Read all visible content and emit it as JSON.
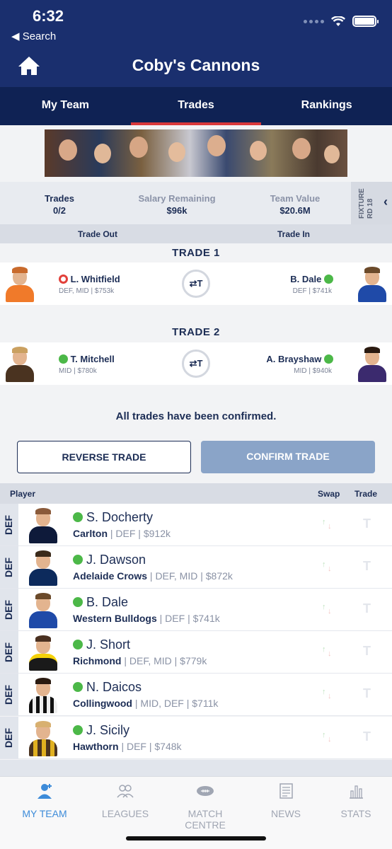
{
  "status": {
    "time": "6:32",
    "back_label": "Search"
  },
  "header": {
    "title": "Coby's Cannons"
  },
  "tabs": [
    {
      "label": "My Team"
    },
    {
      "label": "Trades"
    },
    {
      "label": "Rankings"
    }
  ],
  "summary": {
    "trades": {
      "label": "Trades",
      "value": "0/2"
    },
    "salary": {
      "label": "Salary Remaining",
      "value": "$96k"
    },
    "team_value": {
      "label": "Team Value",
      "value": "$20.6M"
    },
    "fixture_line1": "FIXTURE",
    "fixture_line2": "RD 18"
  },
  "trade_header": {
    "out_label": "Trade Out",
    "in_label": "Trade In"
  },
  "trades": [
    {
      "title": "TRADE 1",
      "out": {
        "name": "L. Whitfield",
        "meta": "DEF, MID | $753k",
        "status": "injured"
      },
      "in": {
        "name": "B. Dale",
        "meta": "DEF | $741k",
        "status": "available"
      },
      "swap_label": "⇄T"
    },
    {
      "title": "TRADE 2",
      "out": {
        "name": "T. Mitchell",
        "meta": "MID | $780k",
        "status": "available"
      },
      "in": {
        "name": "A. Brayshaw",
        "meta": "MID | $940k",
        "status": "available"
      },
      "swap_label": "⇄T"
    }
  ],
  "confirmation_message": "All trades have been confirmed.",
  "buttons": {
    "reverse": "REVERSE TRADE",
    "confirm": "CONFIRM TRADE"
  },
  "list_header": {
    "player": "Player",
    "swap": "Swap",
    "trade": "Trade"
  },
  "players": [
    {
      "pos": "DEF",
      "name": "S. Docherty",
      "club": "Carlton",
      "details": " | DEF | $912k"
    },
    {
      "pos": "DEF",
      "name": "J. Dawson",
      "club": "Adelaide Crows",
      "details": " | DEF, MID | $872k"
    },
    {
      "pos": "DEF",
      "name": "B. Dale",
      "club": "Western Bulldogs",
      "details": " | DEF | $741k"
    },
    {
      "pos": "DEF",
      "name": "J. Short",
      "club": "Richmond",
      "details": " | DEF, MID | $779k"
    },
    {
      "pos": "DEF",
      "name": "N. Daicos",
      "club": "Collingwood",
      "details": " | MID, DEF | $711k"
    },
    {
      "pos": "DEF",
      "name": "J. Sicily",
      "club": "Hawthorn",
      "details": " | DEF | $748k"
    }
  ],
  "nav": [
    {
      "label": "MY TEAM",
      "icon": "person-plus-icon"
    },
    {
      "label": "LEAGUES",
      "icon": "group-icon"
    },
    {
      "label": "MATCH CENTRE",
      "icon": "football-icon"
    },
    {
      "label": "NEWS",
      "icon": "newspaper-icon"
    },
    {
      "label": "STATS",
      "icon": "bar-chart-icon"
    }
  ],
  "colors": {
    "navy": "#1a2f6e",
    "dark_navy": "#0f2254",
    "accent_red": "#d9383a",
    "green": "#4cb848",
    "active_blue": "#3d8bd9"
  }
}
